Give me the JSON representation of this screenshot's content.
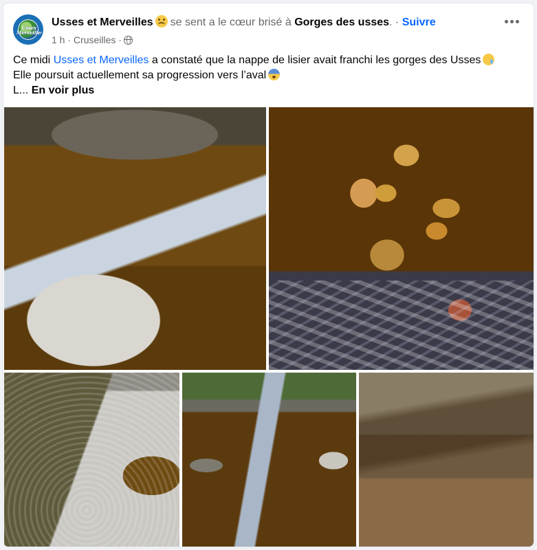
{
  "post": {
    "page_name": "Usses et Merveilles",
    "feeling_text": "se sent a le cœur brisé à",
    "location": "Gorges des usses",
    "separator": ". ·",
    "follow_label": "Suivre",
    "time": "1 h",
    "city": "Cruseilles",
    "dot": "·",
    "avatar_logo_text": "Usses Merveilles",
    "more_icon": "more-horizontal-icon",
    "feeling_icon": "broken-heart-face-emoji",
    "privacy_icon": "globe-icon",
    "text": {
      "line1_before": "Ce midi ",
      "line1_mention": "Usses et Merveilles",
      "line1_after": " a constaté que la nappe de lisier avait franchi les gorges des Usses",
      "line2": "Elle poursuit actuellement sa progression vers l’aval",
      "line3_prefix": "L...",
      "see_more": "En voir plus"
    }
  },
  "photos": [
    {
      "name": "photo-river-rock"
    },
    {
      "name": "photo-brown-water-stones"
    },
    {
      "name": "photo-foam-rock"
    },
    {
      "name": "photo-gorge-reflection"
    },
    {
      "name": "photo-murky-water"
    }
  ]
}
